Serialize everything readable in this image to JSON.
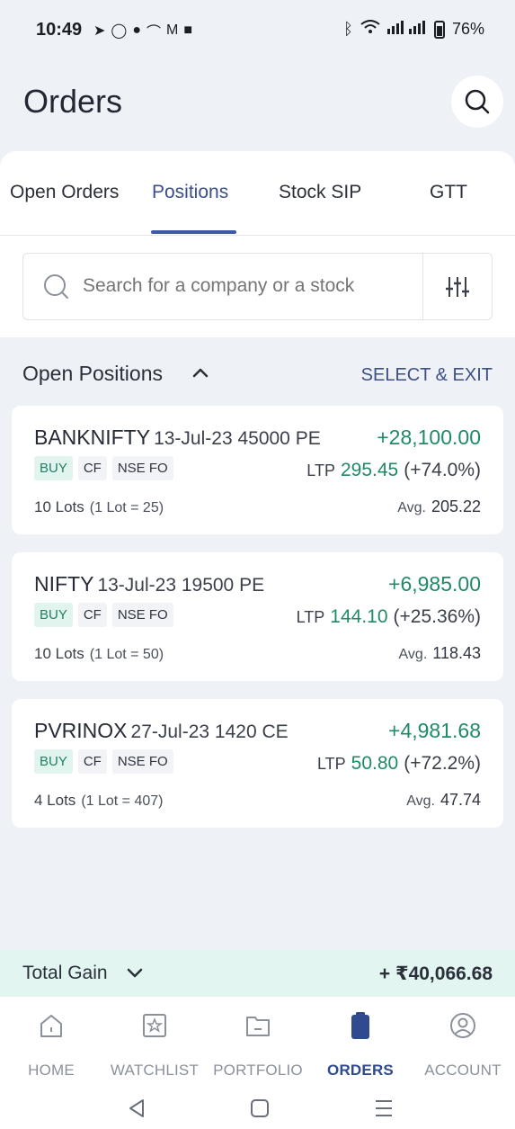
{
  "status_bar": {
    "time": "10:49",
    "battery": "76%"
  },
  "header": {
    "title": "Orders"
  },
  "tabs": [
    {
      "label": "Open Orders",
      "active": false
    },
    {
      "label": "Positions",
      "active": true
    },
    {
      "label": "Stock SIP",
      "active": false
    },
    {
      "label": "GTT",
      "active": false
    }
  ],
  "search": {
    "placeholder": "Search for a company or a stock"
  },
  "positions": {
    "title": "Open Positions",
    "select_exit": "SELECT & EXIT",
    "items": [
      {
        "symbol": "BANKNIFTY",
        "contract": "13-Jul-23 45000 PE",
        "pnl": "+28,100.00",
        "tags": [
          "BUY",
          "CF",
          "NSE FO"
        ],
        "ltp_label": "LTP",
        "ltp": "295.45",
        "ltp_change": "(+74.0%)",
        "lots": "10 Lots",
        "lot_size": "(1 Lot = 25)",
        "avg_label": "Avg.",
        "avg": "205.22"
      },
      {
        "symbol": "NIFTY",
        "contract": "13-Jul-23 19500 PE",
        "pnl": "+6,985.00",
        "tags": [
          "BUY",
          "CF",
          "NSE FO"
        ],
        "ltp_label": "LTP",
        "ltp": "144.10",
        "ltp_change": "(+25.36%)",
        "lots": "10 Lots",
        "lot_size": "(1 Lot = 50)",
        "avg_label": "Avg.",
        "avg": "118.43"
      },
      {
        "symbol": "PVRINOX",
        "contract": "27-Jul-23 1420 CE",
        "pnl": "+4,981.68",
        "tags": [
          "BUY",
          "CF",
          "NSE FO"
        ],
        "ltp_label": "LTP",
        "ltp": "50.80",
        "ltp_change": "(+72.2%)",
        "lots": "4 Lots",
        "lot_size": "(1 Lot = 407)",
        "avg_label": "Avg.",
        "avg": "47.74"
      }
    ]
  },
  "total": {
    "label": "Total Gain",
    "value": "+ ₹40,066.68"
  },
  "bottom_nav": [
    {
      "label": "HOME",
      "icon": "home-icon",
      "active": false
    },
    {
      "label": "WATCHLIST",
      "icon": "star-icon",
      "active": false
    },
    {
      "label": "PORTFOLIO",
      "icon": "folder-icon",
      "active": false
    },
    {
      "label": "ORDERS",
      "icon": "clipboard-icon",
      "active": true
    },
    {
      "label": "ACCOUNT",
      "icon": "user-icon",
      "active": false
    }
  ],
  "colors": {
    "accent": "#3f58a8",
    "gain": "#1f8a66",
    "background": "#eef1f6"
  }
}
